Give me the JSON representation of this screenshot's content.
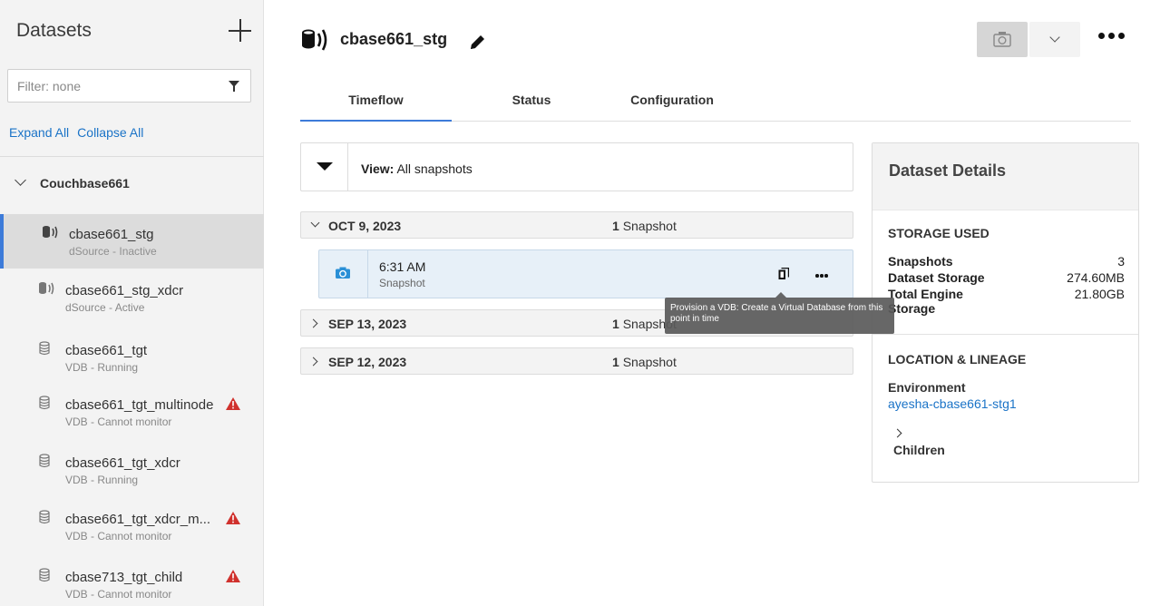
{
  "sidebar": {
    "title": "Datasets",
    "filter_placeholder": "Filter: none",
    "expand_all": "Expand All",
    "collapse_all": "Collapse All",
    "group": "Couchbase661",
    "items": [
      {
        "name": "cbase661_stg",
        "status": "dSource - Inactive",
        "icon": "dsource-icon",
        "selected": true,
        "warning": false
      },
      {
        "name": "cbase661_stg_xdcr",
        "status": "dSource - Active",
        "icon": "dsource-icon",
        "selected": false,
        "warning": false
      },
      {
        "name": "cbase661_tgt",
        "status": "VDB - Running",
        "icon": "database-icon",
        "selected": false,
        "warning": false
      },
      {
        "name": "cbase661_tgt_multinode",
        "status": "VDB - Cannot monitor",
        "icon": "database-icon",
        "selected": false,
        "warning": true
      },
      {
        "name": "cbase661_tgt_xdcr",
        "status": "VDB - Running",
        "icon": "database-icon",
        "selected": false,
        "warning": false
      },
      {
        "name": "cbase661_tgt_xdcr_m...",
        "status": "VDB - Cannot monitor",
        "icon": "database-icon",
        "selected": false,
        "warning": true
      },
      {
        "name": "cbase713_tgt_child",
        "status": "VDB - Cannot monitor",
        "icon": "database-icon",
        "selected": false,
        "warning": true
      }
    ]
  },
  "header": {
    "title": "cbase661_stg"
  },
  "tabs": [
    {
      "label": "Timeflow",
      "active": true
    },
    {
      "label": "Status",
      "active": false
    },
    {
      "label": "Configuration",
      "active": false
    }
  ],
  "view": {
    "label": "View:",
    "value": "All snapshots"
  },
  "timeflow": {
    "dates": [
      {
        "date": "OCT 9, 2023",
        "count": "1",
        "count_label": "Snapshot",
        "expanded": true
      },
      {
        "date": "SEP 13, 2023",
        "count": "1",
        "count_label": "Snapshot",
        "expanded": false
      },
      {
        "date": "SEP 12, 2023",
        "count": "1",
        "count_label": "Snapshot",
        "expanded": false
      }
    ],
    "snapshot": {
      "time": "6:31 AM",
      "type": "Snapshot"
    },
    "tooltip": "Provision a VDB: Create a Virtual Database from this point in time"
  },
  "details": {
    "title": "Dataset Details",
    "storage_title": "STORAGE USED",
    "storage": [
      {
        "key": "Snapshots",
        "value": "3"
      },
      {
        "key": "Dataset Storage",
        "value": "274.60MB"
      },
      {
        "key": "Total Engine Storage",
        "value": "21.80GB"
      }
    ],
    "location_title": "LOCATION & LINEAGE",
    "environment_label": "Environment",
    "environment_value": "ayesha-cbase661-stg1",
    "children_label": "Children"
  },
  "colors": {
    "accent": "#3d7bd9",
    "link": "#1a73c7",
    "warning": "#d0312d",
    "selected_bg": "#dcdcdc",
    "snapshot_bg": "#e7f0f8"
  }
}
